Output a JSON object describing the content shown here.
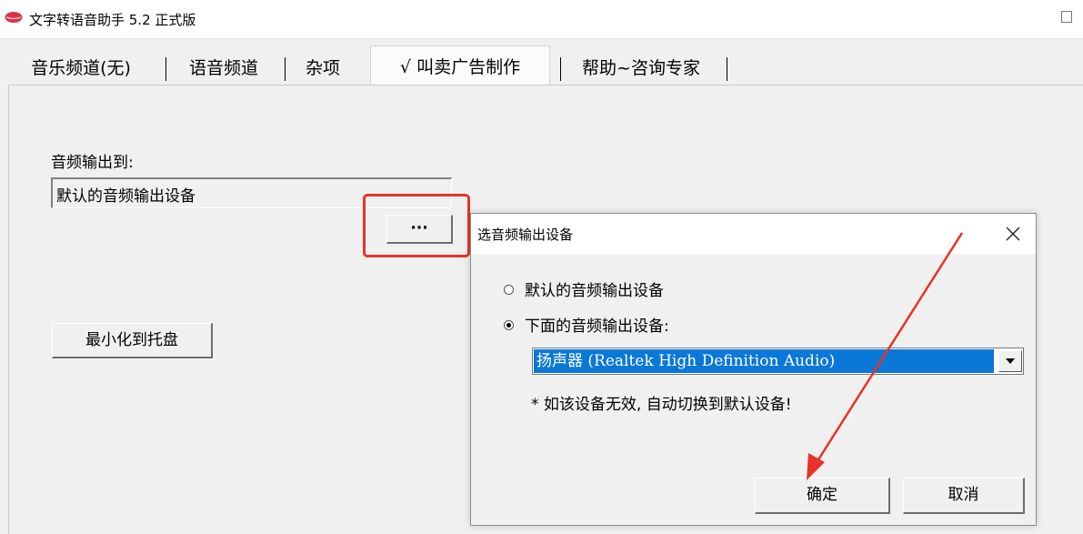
{
  "app": {
    "title": "文字转语音助手 5.2 正式版",
    "icon": "lips-icon",
    "accent": "#d6334a"
  },
  "tabs": [
    {
      "label": "音乐频道(无)"
    },
    {
      "label": "语音频道"
    },
    {
      "label": "杂项"
    },
    {
      "label": "√ 叫卖广告制作",
      "active": true
    },
    {
      "label": "帮助~咨询专家"
    }
  ],
  "panel": {
    "output_label": "音频输出到:",
    "output_value": "默认的音频输出设备",
    "browse_label": "···",
    "minimize_label": "最小化到托盘"
  },
  "dialog": {
    "title": "选音频输出设备",
    "close_icon": "close-icon",
    "radio_default": {
      "label": "默认的音频输出设备",
      "checked": false
    },
    "radio_below": {
      "label": "下面的音频输出设备:",
      "checked": true
    },
    "device_selected": "扬声器 (Realtek High Definition Audio)",
    "note": "* 如该设备无效, 自动切换到默认设备!",
    "ok_label": "确定",
    "cancel_label": "取消"
  },
  "annotation": {
    "highlight_color": "#e8332a"
  }
}
